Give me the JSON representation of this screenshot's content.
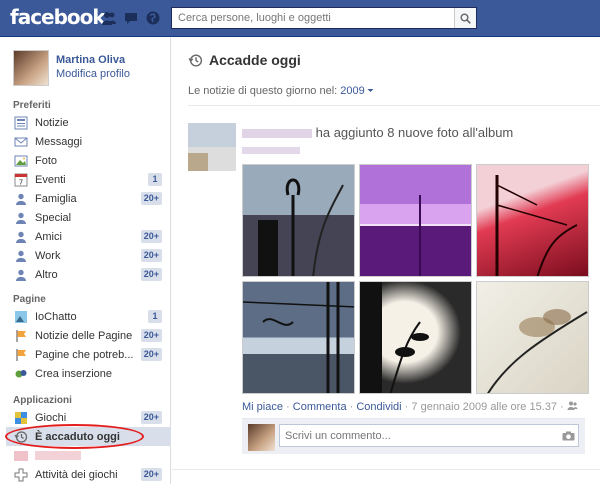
{
  "brand": {
    "name": "facebook",
    "color": "#3b5998"
  },
  "search": {
    "placeholder": "Cerca persone, luoghi e oggetti"
  },
  "profile": {
    "name": "Martina Oliva",
    "edit_label": "Modifica profilo"
  },
  "sections": {
    "favorites": "Preferiti",
    "pages": "Pagine",
    "apps": "Applicazioni"
  },
  "favorites": [
    {
      "label": "Notizie",
      "icon": "news-feed-icon"
    },
    {
      "label": "Messaggi",
      "icon": "messages-icon"
    },
    {
      "label": "Foto",
      "icon": "photos-icon"
    },
    {
      "label": "Eventi",
      "icon": "events-icon",
      "badge": "1"
    },
    {
      "label": "Famiglia",
      "icon": "family-icon",
      "badge": "20+"
    },
    {
      "label": "Special",
      "icon": "special-icon"
    },
    {
      "label": "Amici",
      "icon": "friends-icon",
      "badge": "20+"
    },
    {
      "label": "Work",
      "icon": "work-icon",
      "badge": "20+"
    },
    {
      "label": "Altro",
      "icon": "other-icon",
      "badge": "20+"
    }
  ],
  "pages": [
    {
      "label": "IoChatto",
      "icon": "page-icon",
      "badge": "1"
    },
    {
      "label": "Notizie delle Pagine",
      "icon": "pages-feed-icon",
      "badge": "20+"
    },
    {
      "label": "Pagine che potreb...",
      "icon": "suggested-pages-icon",
      "badge": "20+"
    },
    {
      "label": "Crea inserzione",
      "icon": "ads-icon"
    }
  ],
  "apps": [
    {
      "label": "Giochi",
      "icon": "games-icon",
      "badge": "20+"
    },
    {
      "label": "È accaduto oggi",
      "icon": "history-icon",
      "selected": true
    },
    {
      "label": "",
      "icon": "blurred-app-icon"
    },
    {
      "label": "Attività dei giochi",
      "icon": "game-activity-icon",
      "badge": "20+"
    }
  ],
  "main": {
    "title": "Accadde oggi",
    "subhead_prefix": "Le notizie di questo giorno nel:",
    "year": "2009",
    "story_text": "ha aggiunto 8 nuove foto all'album",
    "actions": {
      "like": "Mi piace",
      "comment": "Commenta",
      "share": "Condividi",
      "date": "7 gennaio 2009 alle ore 15.37"
    },
    "comment_placeholder": "Scrivi un commento..."
  },
  "colors": {
    "accent": "#3b5998",
    "badge_bg": "#d8dfea",
    "highlight": "#e31d1d"
  }
}
